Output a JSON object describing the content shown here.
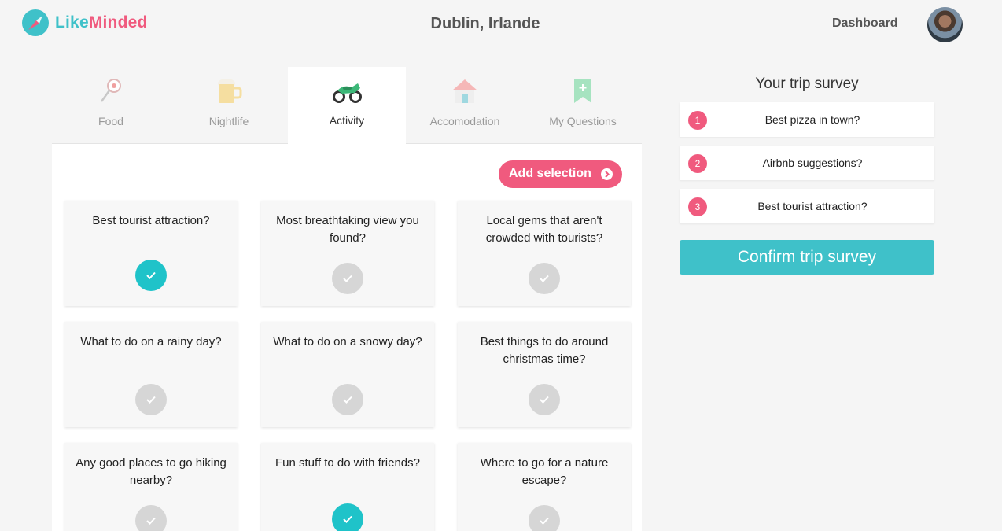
{
  "app": {
    "name_part1": "Like",
    "name_part2": "Minded"
  },
  "header": {
    "city": "Dublin, Irlande",
    "dashboard_label": "Dashboard"
  },
  "colors": {
    "accent": "#3fc1c9",
    "brand_pink": "#f05a7e",
    "selected_check": "#1fc3c9",
    "unselected_check": "#d6d6d6"
  },
  "tabs": [
    {
      "label": "Food",
      "icon": "tennis-racket-icon",
      "active": false
    },
    {
      "label": "Nightlife",
      "icon": "beer-mug-icon",
      "active": false
    },
    {
      "label": "Activity",
      "icon": "motorbike-icon",
      "active": true
    },
    {
      "label": "Accomodation",
      "icon": "house-icon",
      "active": false
    },
    {
      "label": "My Questions",
      "icon": "bookmark-plus-icon",
      "active": false
    }
  ],
  "add_selection_label": "Add selection",
  "questions": [
    {
      "text": "Best tourist attraction?",
      "selected": true
    },
    {
      "text": "Most breathtaking view you found?",
      "selected": false
    },
    {
      "text": "Local gems that aren't crowded with tourists?",
      "selected": false
    },
    {
      "text": "What to do on a rainy day?",
      "selected": false
    },
    {
      "text": "What to do on a snowy day?",
      "selected": false
    },
    {
      "text": "Best things to do around christmas time?",
      "selected": false
    },
    {
      "text": "Any good places to go hiking nearby?",
      "selected": false
    },
    {
      "text": "Fun stuff to do with friends?",
      "selected": true
    },
    {
      "text": "Where to go for a nature escape?",
      "selected": false
    }
  ],
  "survey": {
    "title": "Your trip survey",
    "items": [
      {
        "num": "1",
        "text": "Best pizza in town?"
      },
      {
        "num": "2",
        "text": "Airbnb suggestions?"
      },
      {
        "num": "3",
        "text": "Best tourist attraction?"
      }
    ],
    "confirm_label": "Confirm trip survey"
  }
}
